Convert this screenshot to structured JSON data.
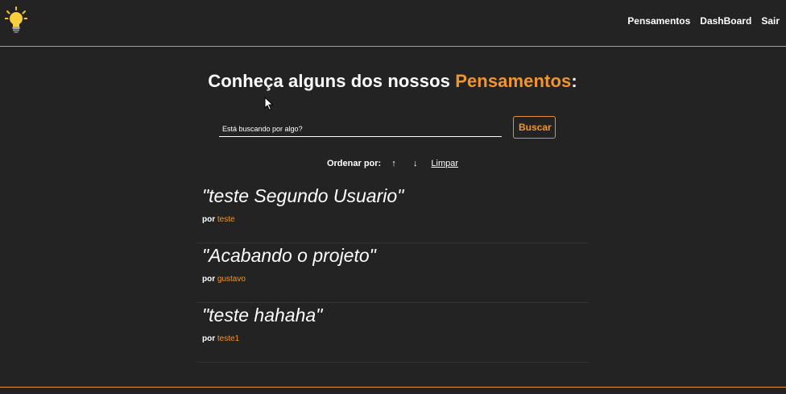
{
  "nav": {
    "logo_icon": "lightbulb-icon",
    "links": [
      "Pensamentos",
      "DashBoard",
      "Sair"
    ]
  },
  "main": {
    "title_prefix": "Conheça alguns dos nossos ",
    "title_accent": "Pensamentos",
    "title_suffix": ":",
    "search": {
      "placeholder": "Está buscando por algo?",
      "value": "",
      "button_label": "Buscar"
    },
    "order": {
      "label": "Ordenar por:",
      "asc_icon": "↑",
      "desc_icon": "↓",
      "clear_label": "Limpar"
    },
    "thoughts": [
      {
        "text": "\"teste Segundo Usuario\"",
        "by": "por",
        "author": "teste"
      },
      {
        "text": "\"Acabando o projeto\"",
        "by": "por",
        "author": "gustavo"
      },
      {
        "text": "\"teste hahaha\"",
        "by": "por",
        "author": "teste1"
      }
    ]
  },
  "colors": {
    "background": "#232323",
    "accent": "#f2952d",
    "border": "#e3922e"
  }
}
